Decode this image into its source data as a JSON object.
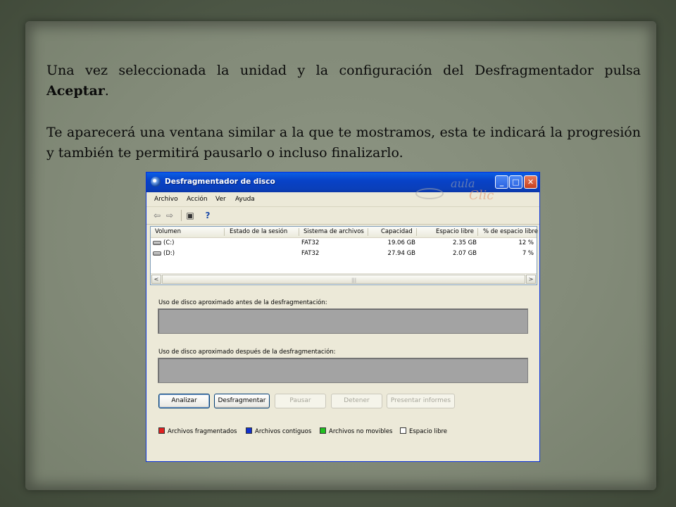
{
  "slide": {
    "paragraph1_pre": "Una vez seleccionada la unidad y la configuración del Desfragmentador pulsa ",
    "paragraph1_bold": "Aceptar",
    "paragraph1_post": ".",
    "paragraph2": "Te aparecerá una ventana similar a la que te mostramos, esta te indicará la progresión y también te permitirá pausarlo o incluso finalizarlo."
  },
  "window": {
    "title": "Desfragmentador de disco",
    "controls": {
      "minimize": "_",
      "maximize": "□",
      "close": "✕"
    },
    "watermark": {
      "line1": "aula",
      "line2": "Clic"
    }
  },
  "menu": [
    "Archivo",
    "Acción",
    "Ver",
    "Ayuda"
  ],
  "toolbar": {
    "icons": [
      "back-arrow-icon",
      "forward-arrow-icon",
      "console-tree-icon",
      "help-icon"
    ],
    "glyphs": [
      "⇦",
      "⇨",
      "▣",
      "?"
    ]
  },
  "volumes": {
    "columns": [
      "Volumen",
      "Estado de la sesión",
      "Sistema de archivos",
      "Capacidad",
      "Espacio libre",
      "% de espacio libre"
    ],
    "rows": [
      {
        "volume": "(C:)",
        "status": "",
        "fs": "FAT32",
        "capacity": "19.06 GB",
        "free": "2.35 GB",
        "pct": "12 %"
      },
      {
        "volume": "(D:)",
        "status": "",
        "fs": "FAT32",
        "capacity": "27.94 GB",
        "free": "2.07 GB",
        "pct": "7 %"
      }
    ],
    "scroll": {
      "left": "<",
      "right": ">",
      "grip": "|||"
    }
  },
  "usage": {
    "before_label": "Uso de disco aproximado antes de la desfragmentación:",
    "after_label": "Uso de disco aproximado después de la desfragmentación:"
  },
  "buttons": {
    "analyze": "Analizar",
    "defragment": "Desfragmentar",
    "pause": "Pausar",
    "stop": "Detener",
    "report": "Presentar informes"
  },
  "legend": [
    {
      "label": "Archivos fragmentados",
      "color": "#e02020"
    },
    {
      "label": "Archivos contiguos",
      "color": "#1030d0"
    },
    {
      "label": "Archivos no movibles",
      "color": "#20c020"
    },
    {
      "label": "Espacio libre",
      "color": "#ffffff"
    }
  ]
}
